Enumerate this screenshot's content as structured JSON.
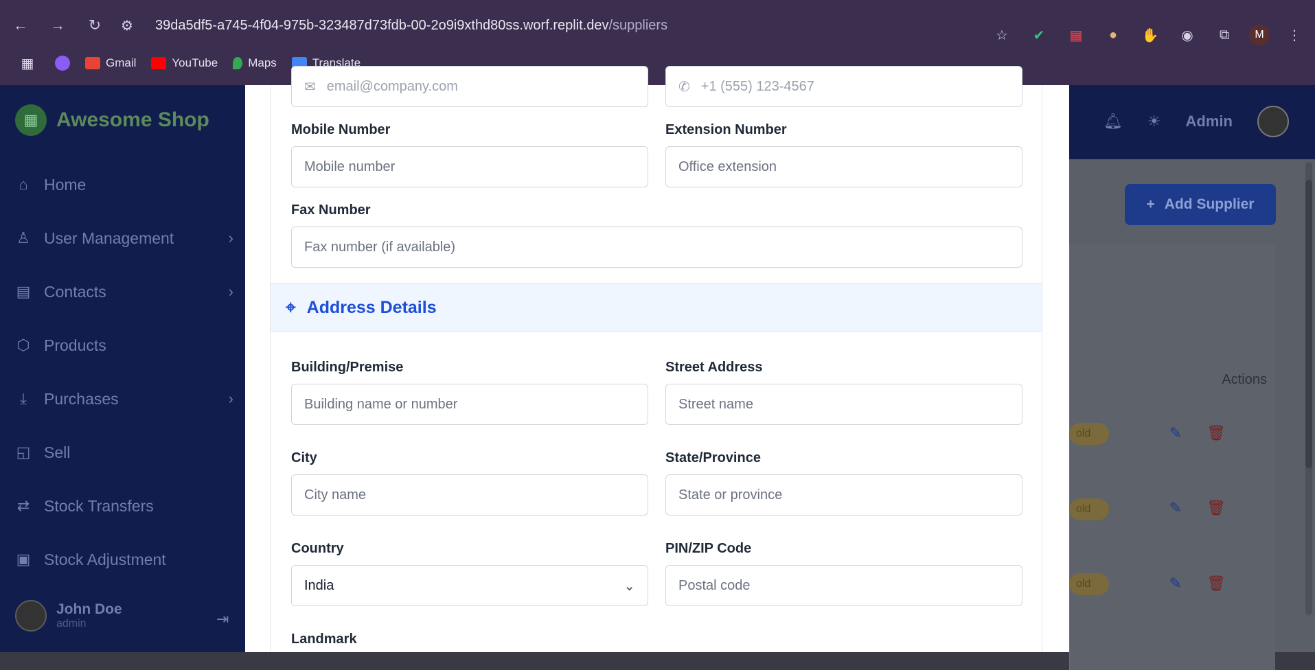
{
  "browser": {
    "url_host": "39da5df5-a745-4f04-975b-323487d73fdb-00-2o9i9xthd80ss.worf.replit.dev",
    "url_path": "/suppliers",
    "profile_initial": "M",
    "bookmarks": [
      {
        "label": "Gmail",
        "color": "#ea4335"
      },
      {
        "label": "YouTube",
        "color": "#ff0000"
      },
      {
        "label": "Maps",
        "color": "#34a853"
      },
      {
        "label": "Translate",
        "color": "#4285f4"
      }
    ]
  },
  "app": {
    "brand": "Awesome Shop",
    "nav": [
      {
        "label": "Home",
        "icon": "home-icon",
        "has_children": false
      },
      {
        "label": "User Management",
        "icon": "user-icon",
        "has_children": true
      },
      {
        "label": "Contacts",
        "icon": "contacts-icon",
        "has_children": true
      },
      {
        "label": "Products",
        "icon": "box-icon",
        "has_children": false
      },
      {
        "label": "Purchases",
        "icon": "download-icon",
        "has_children": true
      },
      {
        "label": "Sell",
        "icon": "bag-icon",
        "has_children": false
      },
      {
        "label": "Stock Transfers",
        "icon": "transfer-icon",
        "has_children": false
      },
      {
        "label": "Stock Adjustment",
        "icon": "clipboard-icon",
        "has_children": false
      }
    ],
    "user": {
      "name": "John Doe",
      "role": "admin"
    },
    "header": {
      "admin_label": "Admin"
    },
    "add_supplier_label": "Add Supplier",
    "table": {
      "actions_header": "Actions",
      "status_fragment": "old"
    }
  },
  "modal": {
    "email": {
      "placeholder": "email@company.com"
    },
    "phone": {
      "placeholder": "+1 (555) 123-4567"
    },
    "mobile": {
      "label": "Mobile Number",
      "placeholder": "Mobile number"
    },
    "extension": {
      "label": "Extension Number",
      "placeholder": "Office extension"
    },
    "fax": {
      "label": "Fax Number",
      "placeholder": "Fax number (if available)"
    },
    "address_section_title": "Address Details",
    "building": {
      "label": "Building/Premise",
      "placeholder": "Building name or number"
    },
    "street": {
      "label": "Street Address",
      "placeholder": "Street name"
    },
    "city": {
      "label": "City",
      "placeholder": "City name"
    },
    "state": {
      "label": "State/Province",
      "placeholder": "State or province"
    },
    "country": {
      "label": "Country",
      "value": "India"
    },
    "pin": {
      "label": "PIN/ZIP Code",
      "placeholder": "Postal code"
    },
    "landmark": {
      "label": "Landmark"
    }
  }
}
